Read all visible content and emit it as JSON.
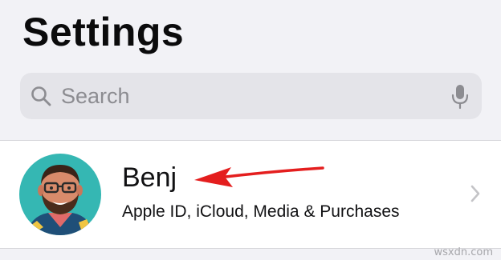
{
  "header": {
    "title": "Settings"
  },
  "search": {
    "placeholder": "Search",
    "leading_icon": "search-icon",
    "trailing_icon": "microphone-icon"
  },
  "profile": {
    "name": "Benj",
    "subtitle": "Apple ID, iCloud, Media & Purchases",
    "avatar_icon": "avatar",
    "disclosure_icon": "chevron-right-icon"
  },
  "annotation": {
    "type": "arrow",
    "color": "#e41e1e",
    "points_to": "profile-name"
  },
  "watermark": "wsxdn.com",
  "colors": {
    "background": "#f2f2f6",
    "search_field": "#e4e4e9",
    "placeholder_text": "#8c8c91",
    "row_background": "#ffffff",
    "chevron": "#c4c4c7"
  }
}
